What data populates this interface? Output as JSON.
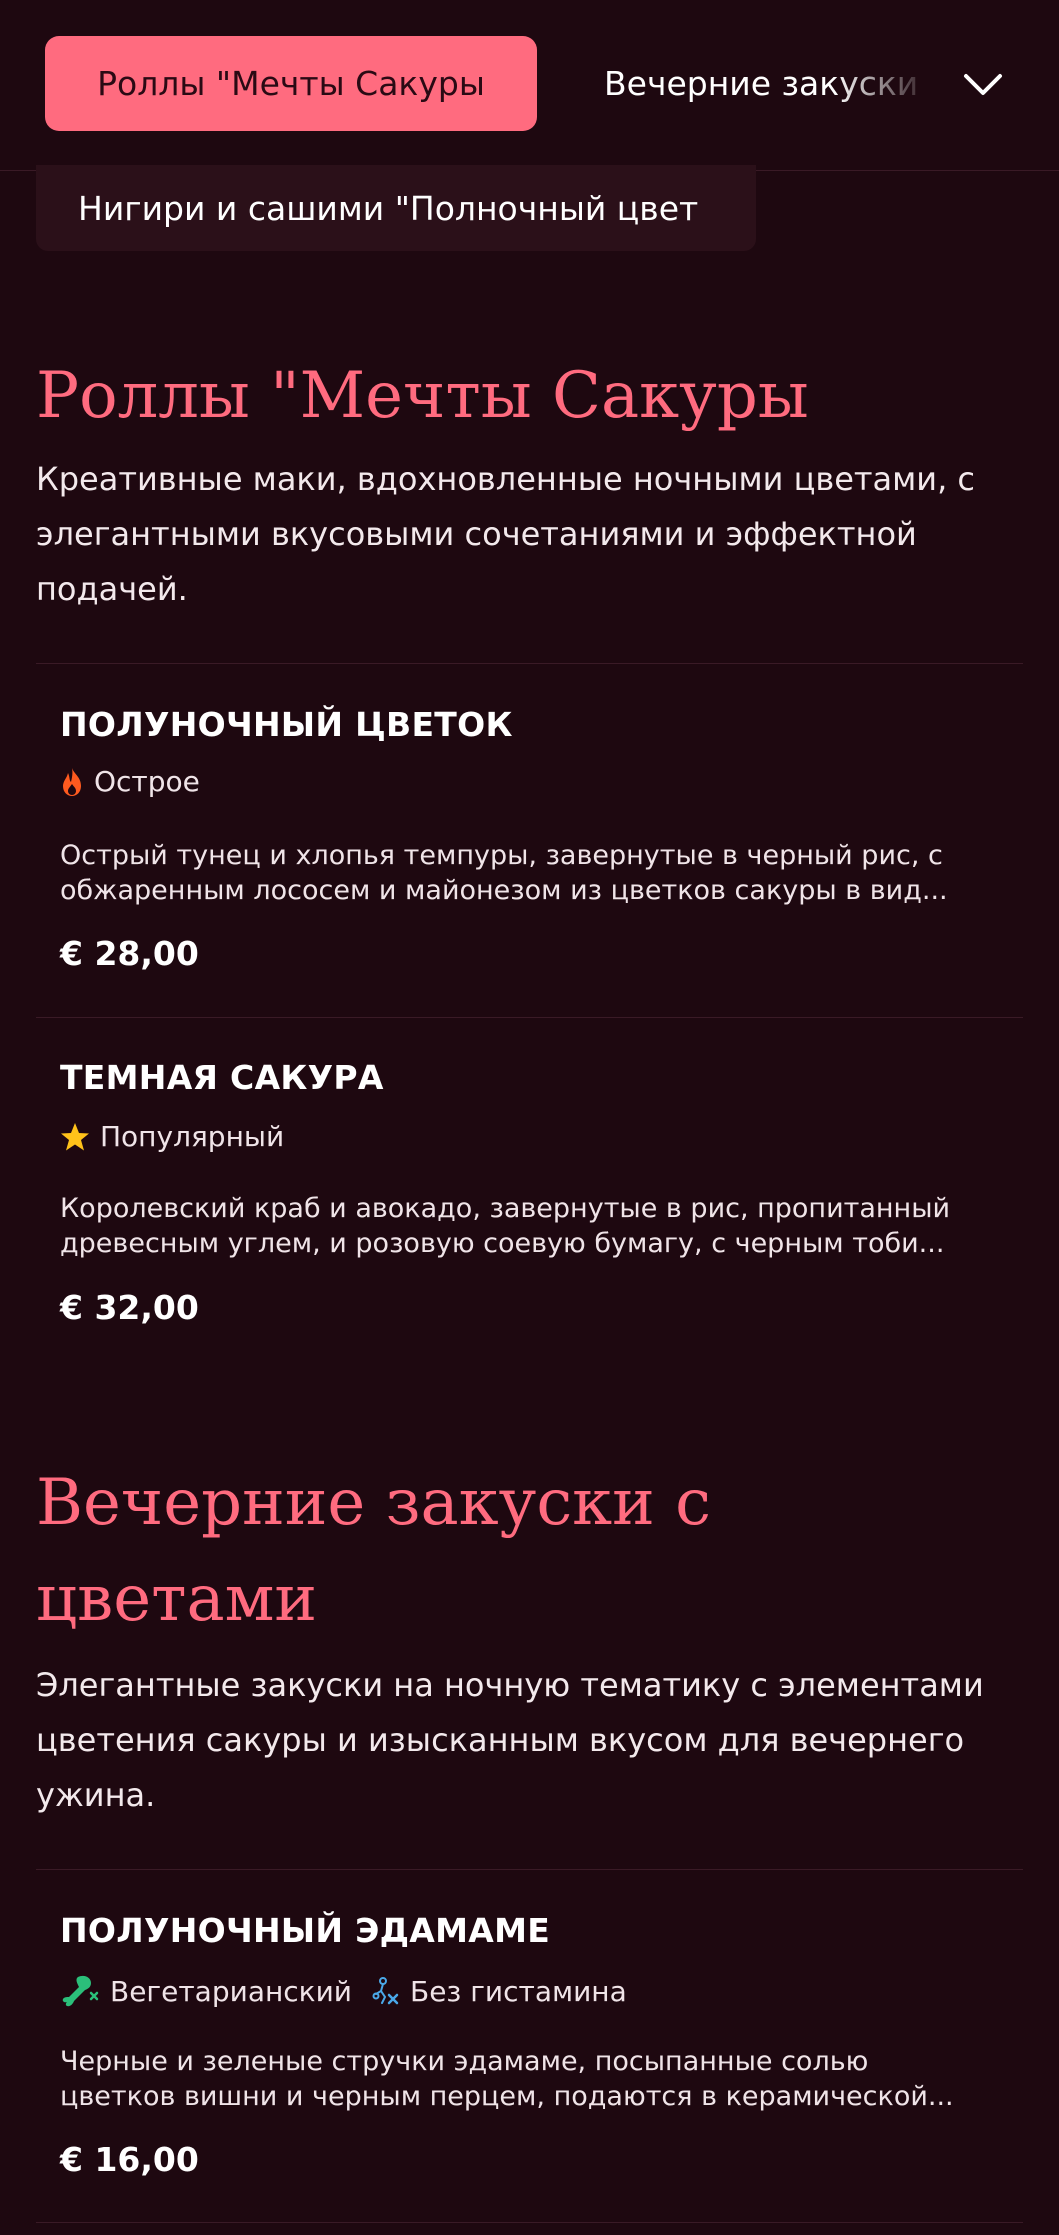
{
  "nav": {
    "active_tab": "Роллы \"Мечты Сакуры",
    "next_tab": "Вечерние закуски",
    "secondary_tab": "Нигири и сашими \"Полночный цвет"
  },
  "sections": [
    {
      "title": "Роллы \"Мечты Сакуры",
      "description": "Креативные маки, вдохновленные ночными цветами, с элегантными вкусовыми сочетаниями и эффектной подачей.",
      "items": [
        {
          "name": "ПОЛУНОЧНЫЙ ЦВЕТОК",
          "tags": [
            {
              "icon": "flame-icon",
              "label": "Острое"
            }
          ],
          "description_line1": "Острый тунец и хлопья темпуры, завернутые в черный рис, с",
          "description_line2": "обжаренным лососем и майонезом из цветков сакуры в вид...",
          "price": "€ 28,00"
        },
        {
          "name": "ТЕМНАЯ САКУРА",
          "tags": [
            {
              "icon": "star-icon",
              "label": "Популярный"
            }
          ],
          "description_line1": "Королевский краб и авокадо, завернутые в рис, пропитанный",
          "description_line2": "древесным углем, и розовую соевую бумагу, с черным тоби...",
          "price": "€ 32,00"
        }
      ]
    },
    {
      "title_line1": "Вечерние закуски с",
      "title_line2": "цветами",
      "description": "Элегантные закуски на ночную тематику с элементами цветения сакуры и изысканным вкусом для вечернего ужина.",
      "items": [
        {
          "name": "ПОЛУНОЧНЫЙ ЭДАМАМЕ",
          "tags": [
            {
              "icon": "vegetarian-leg-icon",
              "label": "Вегетарианский"
            },
            {
              "icon": "histamine-free-icon",
              "label": "Без гистамина"
            }
          ],
          "description_line1": "Черные и зеленые стручки эдамаме, посыпанные солью",
          "description_line2": "цветков вишни и черным перцем, подаются в керамической...",
          "price": "€ 16,00"
        }
      ]
    }
  ],
  "colors": {
    "background": "#1e0810",
    "accent": "#ff6b7f",
    "secondary_bg": "#2b1019",
    "flame": "#ff5a1f",
    "star": "#ffc21a",
    "vegetarian": "#2bbf7a",
    "histamine": "#4aa8e8"
  }
}
